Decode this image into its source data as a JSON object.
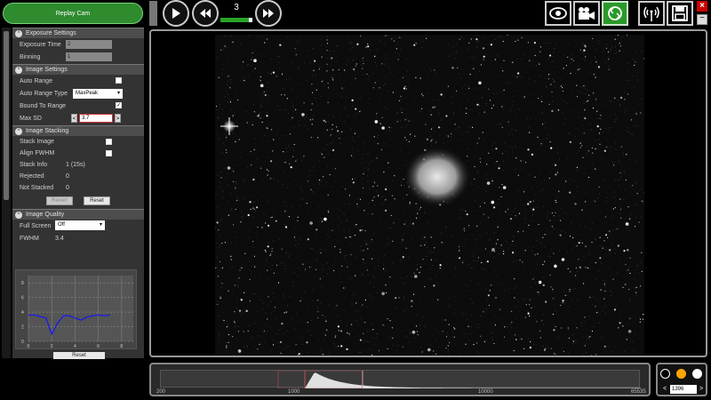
{
  "header": {
    "replay_button": "Replay Cam",
    "frame_count": "3",
    "frame_progress": 0.88
  },
  "panel": {
    "exposure": {
      "title": "Exposure Settings",
      "exposure_time_label": "Exposure Time",
      "exposure_time_value": "2",
      "binning_label": "Binning",
      "binning_value": "1"
    },
    "image_settings": {
      "title": "Image Settings",
      "auto_range_label": "Auto Range",
      "auto_range_checked": false,
      "auto_range_type_label": "Auto Range Type",
      "auto_range_type_value": "MaxPeak",
      "bound_to_range_label": "Bound To Range",
      "bound_to_range_checked": true,
      "max_sd_label": "Max SD",
      "max_sd_value": "3.7"
    },
    "stacking": {
      "title": "Image Stacking",
      "stack_image_label": "Stack Image",
      "align_fwhm_label": "Align FWHM",
      "stack_info_label": "Stack Info",
      "stack_info_value": "1 (15s)",
      "rejected_label": "Rejected",
      "rejected_value": "0",
      "not_stacked_label": "Not Stacked",
      "not_stacked_value": "0",
      "revert_label": "Revert",
      "reset_label": "Reset"
    },
    "quality": {
      "title": "Image Quality",
      "full_screen_label": "Full Screen",
      "full_screen_value": "Off",
      "fwhm_label": "FWHM",
      "fwhm_value": "3.4",
      "reset_label": "Reset"
    }
  },
  "chart_data": {
    "type": "line",
    "x": [
      0,
      0.5,
      1,
      1.5,
      2,
      2.5,
      3,
      3.5,
      4,
      4.5,
      5,
      5.5,
      6,
      6.5,
      7
    ],
    "series": [
      {
        "values": [
          3.6,
          3.6,
          3.4,
          3.2,
          1.0,
          2.5,
          3.5,
          3.5,
          3.2,
          2.9,
          3.3,
          3.5,
          3.6,
          3.5,
          3.6
        ]
      }
    ],
    "x_ticks": [
      "0",
      "2",
      "4",
      "6",
      "8"
    ],
    "y_ticks": [
      "0",
      "2",
      "4",
      "6",
      "8"
    ],
    "xlim": [
      0,
      9
    ],
    "ylim": [
      0,
      9
    ],
    "color": "#1a1aee"
  },
  "histogram": {
    "labels": [
      "200",
      "1000",
      "10000",
      "65535"
    ],
    "marker_positions": [
      0.3,
      0.42
    ]
  },
  "color_panel": {
    "value": "1396",
    "colors": [
      "#000000",
      "#ffa500",
      "#ffffff"
    ]
  }
}
